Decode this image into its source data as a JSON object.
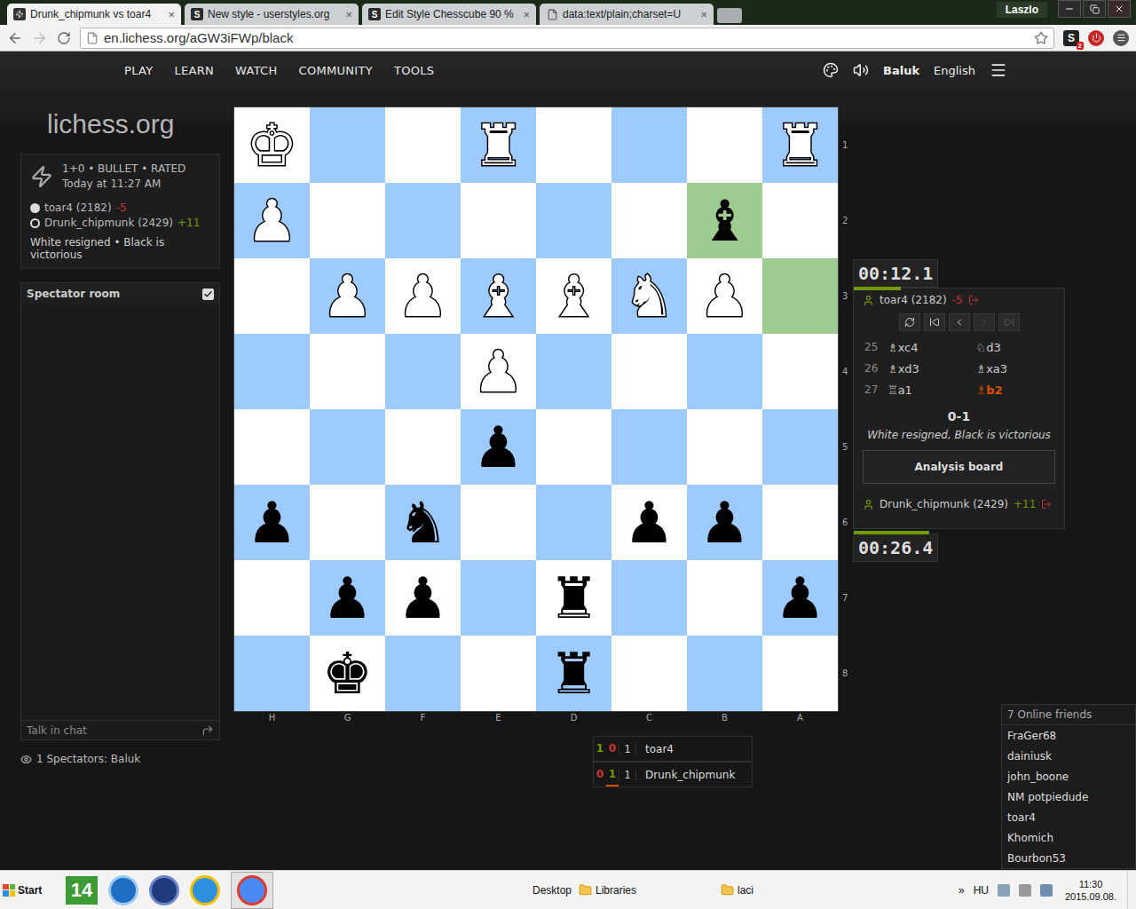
{
  "browser": {
    "tabs": [
      {
        "label": "Drunk_chipmunk vs toar4",
        "selected": true,
        "favicon": "",
        "kind": "knight",
        "close": "×"
      },
      {
        "label": "New style - userstyles.org",
        "selected": false,
        "favicon": "S",
        "kind": "letter",
        "close": "×"
      },
      {
        "label": "Edit Style Chesscube 90 %",
        "selected": false,
        "favicon": "S",
        "kind": "letter",
        "close": "×"
      },
      {
        "label": "data:text/plain;charset=U",
        "selected": false,
        "favicon": "",
        "kind": "file",
        "close": "×"
      }
    ],
    "user": "Laszlo",
    "url": "en.lichess.org/aGW3iFWp/black",
    "extensions": {
      "stylish": "S",
      "badge": "2"
    }
  },
  "header": {
    "nav": [
      "PLAY",
      "LEARN",
      "WATCH",
      "COMMUNITY",
      "TOOLS"
    ],
    "user": "Baluk",
    "language": "English",
    "logo": "lichess.org"
  },
  "game_info": {
    "type": "1+0 • BULLET • RATED",
    "date": "Today at 11:27 AM",
    "players": [
      {
        "name": "toar4 (2182)",
        "diff": "-5",
        "side": "white",
        "color": "#cc3333"
      },
      {
        "name": "Drunk_chipmunk (2429)",
        "diff": "+11",
        "side": "black",
        "color": "#759900"
      }
    ],
    "result": "White resigned • Black is victorious"
  },
  "spectator_room": {
    "title": "Spectator room",
    "checked": true,
    "placeholder": "Talk in chat",
    "spectators": "1 Spectators: Baluk"
  },
  "board": {
    "files": [
      "H",
      "G",
      "F",
      "E",
      "D",
      "C",
      "B",
      "A"
    ],
    "ranks": [
      {
        "label": "1",
        "cells": [
          {
            "piece": "♚",
            "side": "white",
            "highlighted": false
          },
          {
            "piece": "",
            "side": "none",
            "highlighted": false
          },
          {
            "piece": "",
            "side": "none",
            "highlighted": false
          },
          {
            "piece": "♜",
            "side": "white",
            "highlighted": false
          },
          {
            "piece": "",
            "side": "none",
            "highlighted": false
          },
          {
            "piece": "",
            "side": "none",
            "highlighted": false
          },
          {
            "piece": "",
            "side": "none",
            "highlighted": false
          },
          {
            "piece": "♜",
            "side": "white",
            "highlighted": false
          }
        ]
      },
      {
        "label": "2",
        "cells": [
          {
            "piece": "♟",
            "side": "white",
            "highlighted": false
          },
          {
            "piece": "",
            "side": "none",
            "highlighted": false
          },
          {
            "piece": "",
            "side": "none",
            "highlighted": false
          },
          {
            "piece": "",
            "side": "none",
            "highlighted": false
          },
          {
            "piece": "",
            "side": "none",
            "highlighted": false
          },
          {
            "piece": "",
            "side": "none",
            "highlighted": false
          },
          {
            "piece": "♝",
            "side": "black",
            "highlighted": true
          },
          {
            "piece": "",
            "side": "none",
            "highlighted": false
          }
        ]
      },
      {
        "label": "3",
        "cells": [
          {
            "piece": "",
            "side": "none",
            "highlighted": false
          },
          {
            "piece": "♟",
            "side": "white",
            "highlighted": false
          },
          {
            "piece": "♟",
            "side": "white",
            "highlighted": false
          },
          {
            "piece": "♝",
            "side": "white",
            "highlighted": false
          },
          {
            "piece": "♝",
            "side": "white",
            "highlighted": false
          },
          {
            "piece": "♞",
            "side": "white",
            "highlighted": false
          },
          {
            "piece": "♟",
            "side": "white",
            "highlighted": false
          },
          {
            "piece": "",
            "side": "none",
            "highlighted": true
          }
        ]
      },
      {
        "label": "4",
        "cells": [
          {
            "piece": "",
            "side": "none",
            "highlighted": false
          },
          {
            "piece": "",
            "side": "none",
            "highlighted": false
          },
          {
            "piece": "",
            "side": "none",
            "highlighted": false
          },
          {
            "piece": "♟",
            "side": "white",
            "highlighted": false
          },
          {
            "piece": "",
            "side": "none",
            "highlighted": false
          },
          {
            "piece": "",
            "side": "none",
            "highlighted": false
          },
          {
            "piece": "",
            "side": "none",
            "highlighted": false
          },
          {
            "piece": "",
            "side": "none",
            "highlighted": false
          }
        ]
      },
      {
        "label": "5",
        "cells": [
          {
            "piece": "",
            "side": "none",
            "highlighted": false
          },
          {
            "piece": "",
            "side": "none",
            "highlighted": false
          },
          {
            "piece": "",
            "side": "none",
            "highlighted": false
          },
          {
            "piece": "♟",
            "side": "black",
            "highlighted": false
          },
          {
            "piece": "",
            "side": "none",
            "highlighted": false
          },
          {
            "piece": "",
            "side": "none",
            "highlighted": false
          },
          {
            "piece": "",
            "side": "none",
            "highlighted": false
          },
          {
            "piece": "",
            "side": "none",
            "highlighted": false
          }
        ]
      },
      {
        "label": "6",
        "cells": [
          {
            "piece": "♟",
            "side": "black",
            "highlighted": false
          },
          {
            "piece": "",
            "side": "none",
            "highlighted": false
          },
          {
            "piece": "♞",
            "side": "black",
            "highlighted": false
          },
          {
            "piece": "",
            "side": "none",
            "highlighted": false
          },
          {
            "piece": "",
            "side": "none",
            "highlighted": false
          },
          {
            "piece": "♟",
            "side": "black",
            "highlighted": false
          },
          {
            "piece": "♟",
            "side": "black",
            "highlighted": false
          },
          {
            "piece": "",
            "side": "none",
            "highlighted": false
          }
        ]
      },
      {
        "label": "7",
        "cells": [
          {
            "piece": "",
            "side": "none",
            "highlighted": false
          },
          {
            "piece": "♟",
            "side": "black",
            "highlighted": false
          },
          {
            "piece": "♟",
            "side": "black",
            "highlighted": false
          },
          {
            "piece": "",
            "side": "none",
            "highlighted": false
          },
          {
            "piece": "♜",
            "side": "black",
            "highlighted": false
          },
          {
            "piece": "",
            "side": "none",
            "highlighted": false
          },
          {
            "piece": "",
            "side": "none",
            "highlighted": false
          },
          {
            "piece": "♟",
            "side": "black",
            "highlighted": false
          }
        ]
      },
      {
        "label": "8",
        "cells": [
          {
            "piece": "",
            "side": "none",
            "highlighted": false
          },
          {
            "piece": "♚",
            "side": "black",
            "highlighted": false
          },
          {
            "piece": "",
            "side": "none",
            "highlighted": false
          },
          {
            "piece": "",
            "side": "none",
            "highlighted": false
          },
          {
            "piece": "♜",
            "side": "black",
            "highlighted": false
          },
          {
            "piece": "",
            "side": "none",
            "highlighted": false
          },
          {
            "piece": "",
            "side": "none",
            "highlighted": false
          },
          {
            "piece": "",
            "side": "none",
            "highlighted": false
          }
        ]
      }
    ]
  },
  "side_panel": {
    "top_clock": {
      "time": "00:12.1",
      "level": 0.56
    },
    "bottom_clock": {
      "time": "00:26.4",
      "level": 0.9
    },
    "top_player": {
      "name": "toar4 (2182)",
      "diff": "-5",
      "color": "#cc3333"
    },
    "bottom_player": {
      "name": "Drunk_chipmunk (2429)",
      "diff": "+11",
      "color": "#759900"
    },
    "controls": [
      {
        "disabled": false
      },
      {
        "disabled": false
      },
      {
        "disabled": false
      },
      {
        "disabled": true
      },
      {
        "disabled": true
      }
    ],
    "moves": [
      {
        "num": "25",
        "white": {
          "san": "♗xc4",
          "active": false
        },
        "black": {
          "san": "♘d3",
          "active": false
        }
      },
      {
        "num": "26",
        "white": {
          "san": "♗xd3",
          "active": false
        },
        "black": {
          "san": "♗xa3",
          "active": false
        }
      },
      {
        "num": "27",
        "white": {
          "san": "♖a1",
          "active": false
        },
        "black": {
          "san": "♗b2",
          "active": true
        }
      }
    ],
    "score": "0-1",
    "result": "White resigned, Black is victorious",
    "analysis_button": "Analysis board"
  },
  "crosstable": {
    "columns": [
      {
        "current": false
      },
      {
        "current": true
      }
    ],
    "rows": [
      {
        "scores": [
          {
            "value": "1",
            "color": "#759900"
          },
          {
            "value": "0",
            "color": "#cc3333"
          }
        ],
        "total": "1",
        "name": "toar4"
      },
      {
        "scores": [
          {
            "value": "0",
            "color": "#cc3333"
          },
          {
            "value": "1",
            "color": "#759900"
          }
        ],
        "total": "1",
        "name": "Drunk_chipmunk"
      }
    ]
  },
  "friends": {
    "title": "7 Online friends",
    "items": [
      "FraGer68",
      "dainiusk",
      "john_boone",
      "NM potpiedude",
      "toar4",
      "Khomich",
      "Bourbon53"
    ]
  },
  "taskbar": {
    "start": "Start",
    "tile": "14",
    "desktop": "Desktop",
    "folders": [
      "Libraries",
      "laci"
    ],
    "more": "»",
    "lang": "HU",
    "time": "11:30",
    "date": "2015.09.08."
  }
}
